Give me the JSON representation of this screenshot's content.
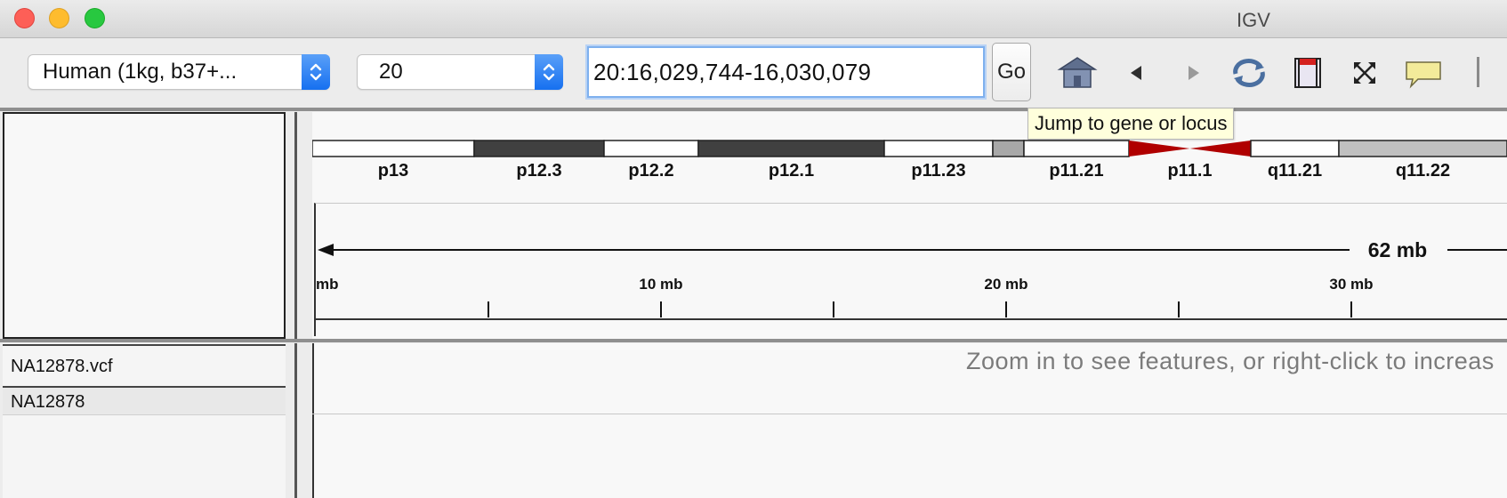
{
  "window": {
    "title": "IGV"
  },
  "toolbar": {
    "genome_value": "Human (1kg, b37+...",
    "chromosome_value": "20",
    "locus_value": "20:16,029,744-16,030,079",
    "go_label": "Go",
    "icons": [
      "home-icon",
      "back-icon",
      "forward-icon",
      "refresh-icon",
      "roi-icon",
      "resize-icon",
      "popup-info-icon"
    ]
  },
  "tooltip": {
    "text": "Jump to gene or locus"
  },
  "ideogram": {
    "bands": [
      {
        "label": "p13",
        "stain": "#ffffff"
      },
      {
        "label": "p12.3",
        "stain": "#404040"
      },
      {
        "label": "p12.2",
        "stain": "#ffffff"
      },
      {
        "label": "p12.1",
        "stain": "#404040"
      },
      {
        "label": "p11.23",
        "stain": "#ffffff"
      },
      {
        "label": "",
        "stain": "#a8a8a8"
      },
      {
        "label": "p11.21",
        "stain": "#ffffff"
      },
      {
        "label": "p11.1",
        "stain": "#b00000"
      },
      {
        "label": "q11.21",
        "stain": "#ffffff"
      },
      {
        "label": "q11.22",
        "stain": "#c0c0c0"
      }
    ],
    "centromere_color": "#b00000"
  },
  "ruler": {
    "span_label": "62 mb",
    "ticks": [
      {
        "label": "mb",
        "value": 0
      },
      {
        "label": "",
        "value": 5
      },
      {
        "label": "10 mb",
        "value": 10
      },
      {
        "label": "",
        "value": 15
      },
      {
        "label": "20 mb",
        "value": 20
      },
      {
        "label": "",
        "value": 25
      },
      {
        "label": "30 mb",
        "value": 30
      }
    ]
  },
  "tracks": {
    "vcf_name": "NA12878.vcf",
    "sample_name": "NA12878",
    "zoom_message": "Zoom in to see features, or right-click to increas"
  }
}
